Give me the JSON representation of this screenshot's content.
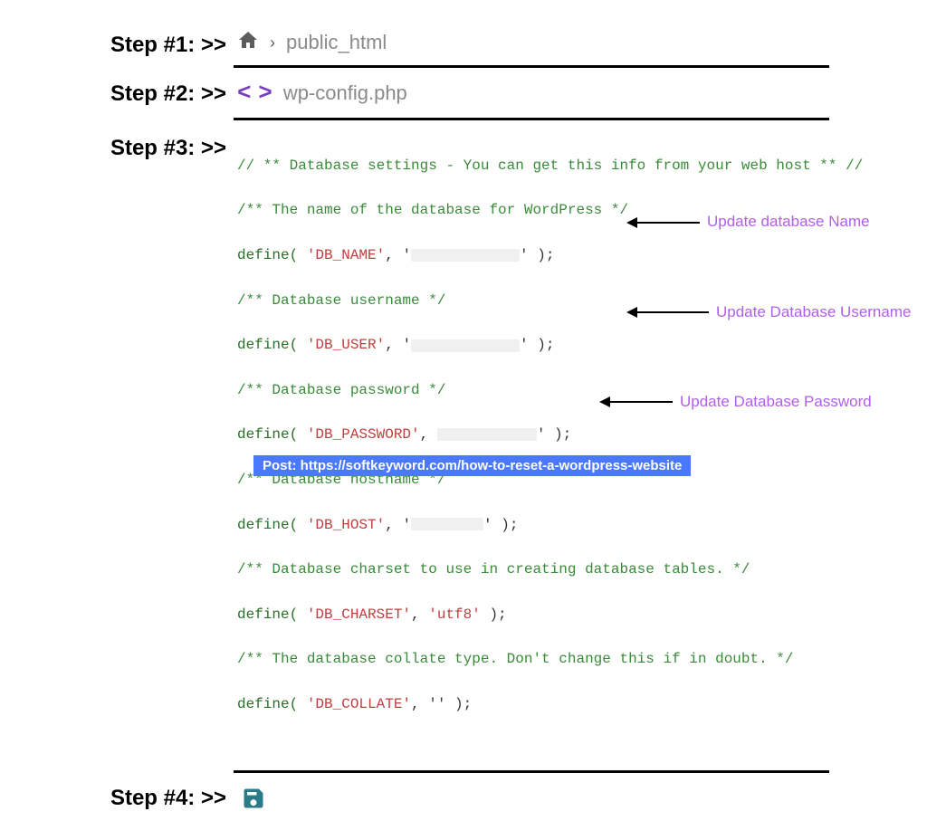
{
  "steps": {
    "s1": {
      "label": "Step #1: >>",
      "path": "public_html"
    },
    "s2": {
      "label": "Step #2: >>",
      "file": "wp-config.php"
    },
    "s3": {
      "label": "Step #3: >>"
    },
    "s4": {
      "label": "Step #4: >>"
    }
  },
  "code": {
    "c1": "// ** Database settings - You can get this info from your web host ** //",
    "c2": "/** The name of the database for WordPress */",
    "l3a": "define( ",
    "l3b": "'DB_NAME'",
    "l3c": ", '",
    "l3d": "' );",
    "c4": "/** Database username */",
    "l5a": "define( ",
    "l5b": "'DB_USER'",
    "l5c": ", '",
    "l5d": "' );",
    "c6": "/** Database password */",
    "l7a": "define( ",
    "l7b": "'DB_PASSWORD'",
    "l7c": ", ",
    "l7d": "' );",
    "c8": "/** Database hostname */",
    "l9a": "define( ",
    "l9b": "'DB_HOST'",
    "l9c": ", '",
    "l9d": "' );",
    "c10": "/** Database charset to use in creating database tables. */",
    "l11a": "define( ",
    "l11b": "'DB_CHARSET'",
    "l11c": ", ",
    "l11d": "'utf8'",
    "l11e": " );",
    "c12": "/** The database collate type. Don't change this if in doubt. */",
    "l13a": "define( ",
    "l13b": "'DB_COLLATE'",
    "l13c": ", '' );"
  },
  "annotations": {
    "a1": "Update database Name",
    "a2": "Update Database Username",
    "a3": "Update Database Password"
  },
  "footer": {
    "post_label": "Post: https://softkeyword.com/how-to-reset-a-wordpress-website"
  }
}
